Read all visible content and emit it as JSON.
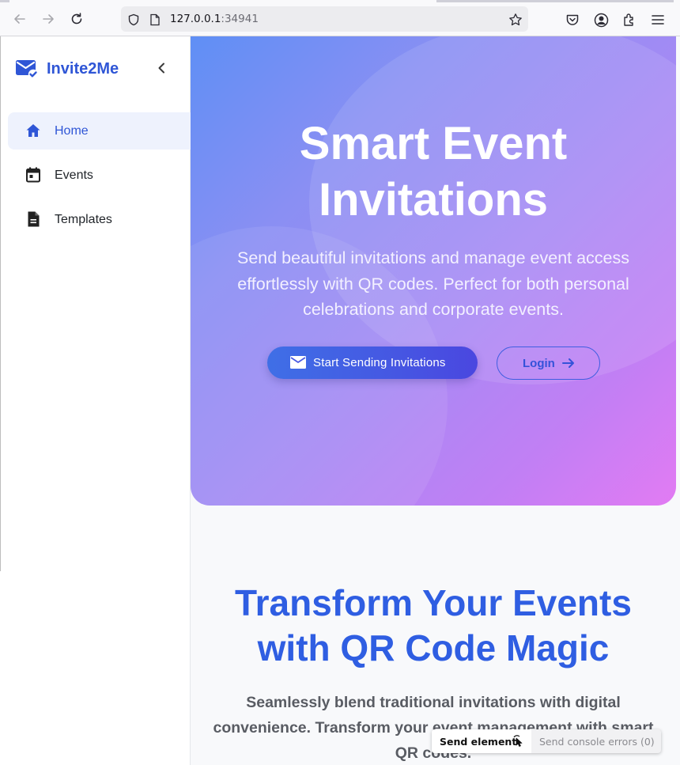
{
  "browser": {
    "url_host": "127.0.0.1",
    "url_port": ":34941"
  },
  "sidebar": {
    "brand": "Invite2Me",
    "items": [
      {
        "label": "Home",
        "icon": "home-icon",
        "active": true
      },
      {
        "label": "Events",
        "icon": "calendar-icon",
        "active": false
      },
      {
        "label": "Templates",
        "icon": "document-icon",
        "active": false
      }
    ]
  },
  "hero": {
    "title_line1": "Smart Event",
    "title_line2": "Invitations",
    "subtitle": "Send beautiful invitations and manage event access effortlessly with QR codes. Perfect for both personal celebrations and corporate events.",
    "primary_button": "Start Sending Invitations",
    "secondary_button": "Login"
  },
  "section": {
    "title_line1": "Transform Your Events",
    "title_line2": "with QR Code Magic",
    "subtitle": "Seamlessly blend traditional invitations with digital convenience. Transform your event management with smart QR codes."
  },
  "toolbar": {
    "send_element": "Send element",
    "send_console_errors": "Send console errors (0)"
  },
  "colors": {
    "brand": "#2f56d6",
    "accent": "#3f5ee0",
    "section_title": "#2f5ee2"
  }
}
